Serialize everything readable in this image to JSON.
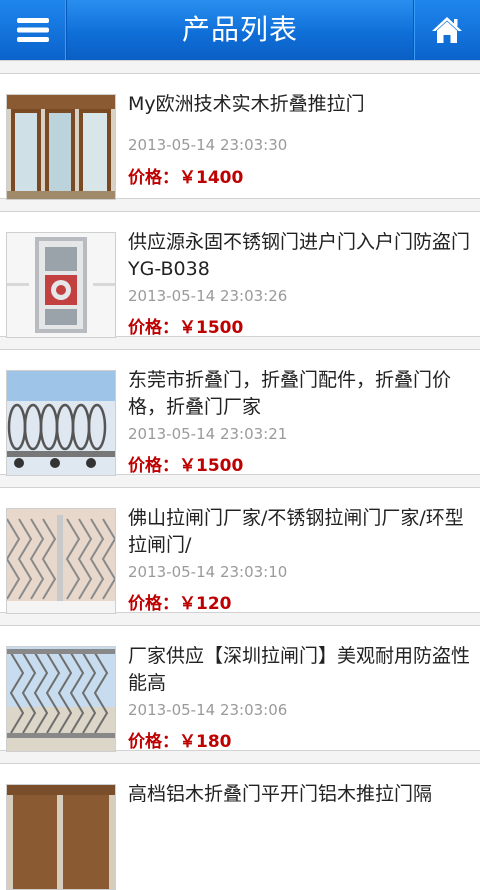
{
  "header": {
    "title": "产品列表",
    "menu_icon": "menu-icon",
    "home_icon": "home-icon"
  },
  "colors": {
    "header_blue": "#0f6fd8",
    "price_red": "#bf0000"
  },
  "products": [
    {
      "name": "My欧洲技术实木折叠推拉门",
      "date": "2013-05-14 23:03:30",
      "price_label": "价格：",
      "price": "￥1400"
    },
    {
      "name": "供应源永固不锈钢门进户门入户门防盗门YG-B038",
      "date": "2013-05-14 23:03:26",
      "price_label": "价格：",
      "price": "￥1500"
    },
    {
      "name": "东莞市折叠门，折叠门配件，折叠门价格，折叠门厂家",
      "date": "2013-05-14 23:03:21",
      "price_label": "价格：",
      "price": "￥1500"
    },
    {
      "name": "佛山拉闸门厂家/不锈钢拉闸门厂家/环型拉闸门/",
      "date": "2013-05-14 23:03:10",
      "price_label": "价格：",
      "price": "￥120"
    },
    {
      "name": "厂家供应【深圳拉闸门】美观耐用防盗性能高",
      "date": "2013-05-14 23:03:06",
      "price_label": "价格：",
      "price": "￥180"
    },
    {
      "name": "高档铝木折叠门平开门铝木推拉门隔"
    }
  ]
}
